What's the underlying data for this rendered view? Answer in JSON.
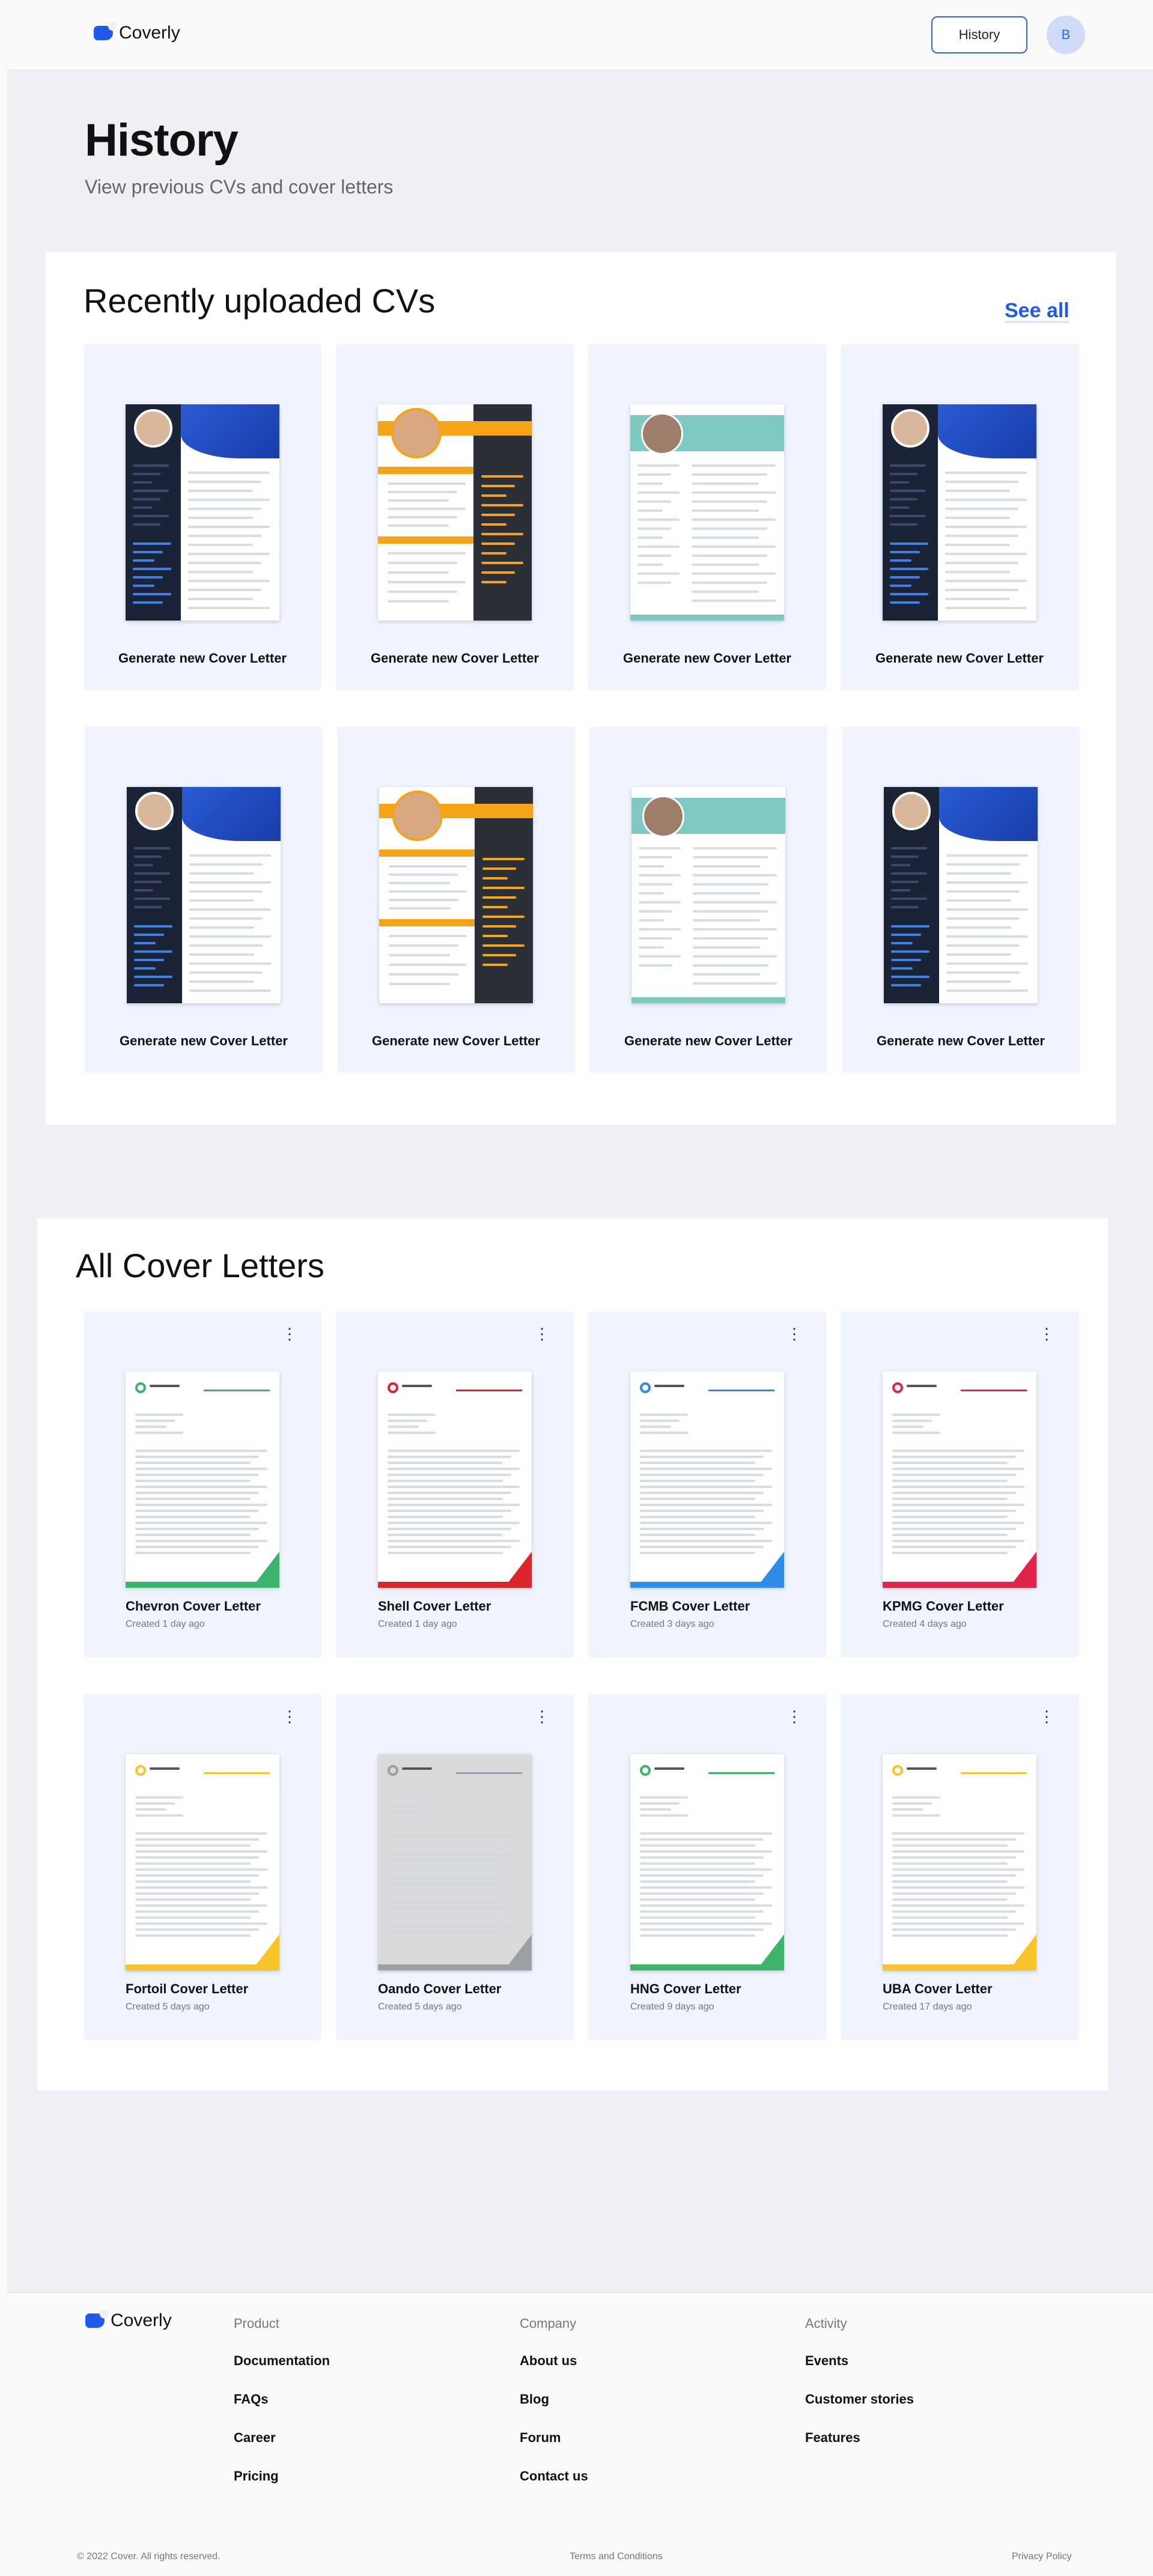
{
  "header": {
    "brand": "Coverly",
    "history_button": "History",
    "avatar_initial": "B",
    "brand_color": "#1f5be8"
  },
  "page": {
    "title": "History",
    "subtitle": "View previous CVs and cover letters"
  },
  "cvs": {
    "title": "Recently uploaded CVs",
    "see_all": "See all",
    "cta": "Generate new  Cover Letter",
    "items": [
      {
        "style": "michael-larsson"
      },
      {
        "style": "kelly-white"
      },
      {
        "style": "laura-anderson"
      },
      {
        "style": "michael-larsson"
      },
      {
        "style": "michael-larsson"
      },
      {
        "style": "kelly-white"
      },
      {
        "style": "laura-anderson"
      },
      {
        "style": "michael-larsson"
      }
    ]
  },
  "cover_letters": {
    "title": "All Cover Letters",
    "items": [
      {
        "name": "Chevron Cover Letter",
        "date": "Created 1 day ago",
        "accent": "#3db36b"
      },
      {
        "name": "Shell Cover Letter",
        "date": "Created 1 day ago",
        "accent": "#d9262c"
      },
      {
        "name": "FCMB Cover Letter",
        "date": "Created 3 days ago",
        "accent": "#2f8de8"
      },
      {
        "name": "KPMG Cover Letter",
        "date": "Created 4 days ago",
        "accent": "#e0244c"
      },
      {
        "name": "Fortoil Cover Letter",
        "date": "Created 5 days ago",
        "accent": "#f7c52a"
      },
      {
        "name": "Oando Cover Letter",
        "date": "Created 5 days ago",
        "accent": "#9aa0a6"
      },
      {
        "name": "HNG Cover Letter",
        "date": "Created 9 days ago",
        "accent": "#3db36b"
      },
      {
        "name": "UBA Cover Letter",
        "date": "Created 17 days ago",
        "accent": "#f7c52a"
      }
    ]
  },
  "footer": {
    "brand": "Coverly",
    "columns": [
      {
        "heading": "Product",
        "links": [
          "Documentation",
          "FAQs",
          "Career",
          "Pricing"
        ]
      },
      {
        "heading": "Company",
        "links": [
          "About us",
          "Blog",
          "Forum",
          "Contact us"
        ]
      },
      {
        "heading": "Activity",
        "links": [
          "Events",
          "Customer stories",
          "Features"
        ]
      }
    ],
    "copyright": "© 2022 Cover. All rights reserved.",
    "terms": "Terms and Conditions",
    "privacy": "Privacy Policy"
  }
}
